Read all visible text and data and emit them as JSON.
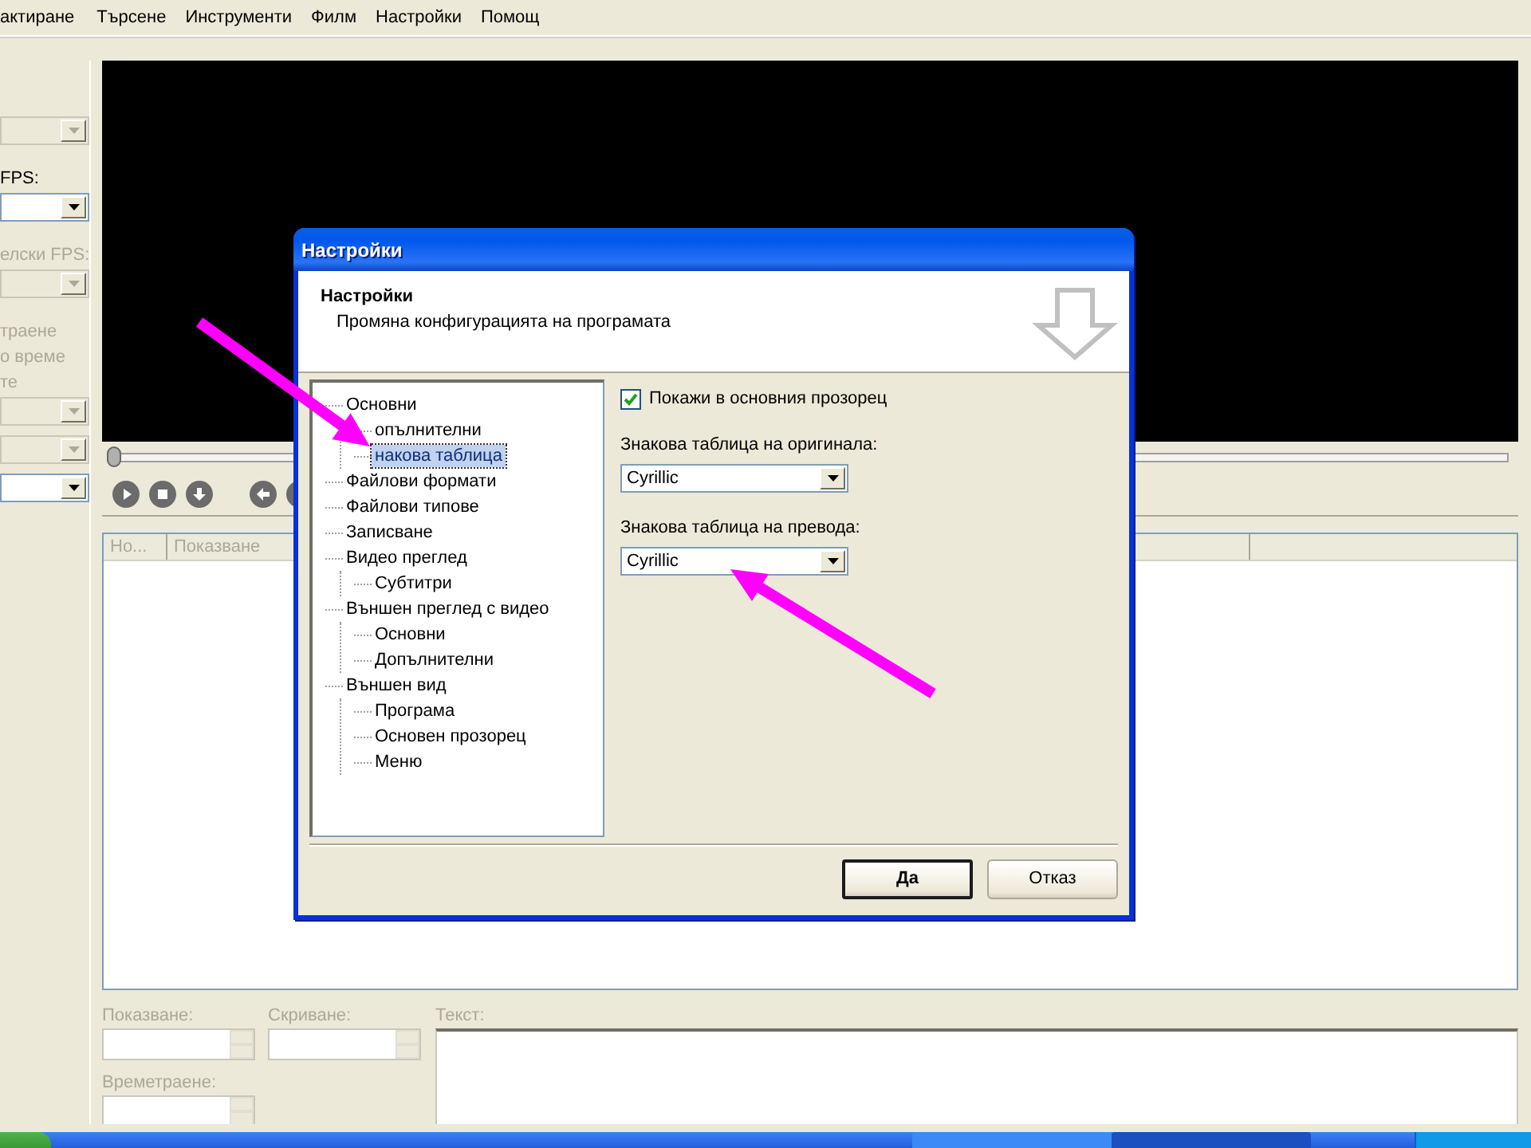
{
  "menu": [
    "актиране",
    "Търсене",
    "Инструменти",
    "Филм",
    "Настройки",
    "Помощ"
  ],
  "left_panel": [
    {
      "kind": "combo",
      "disabled": true
    },
    {
      "kind": "label",
      "text": "FPS:",
      "disabled": false
    },
    {
      "kind": "combo",
      "disabled": false
    },
    {
      "kind": "label",
      "text": "елски FPS:",
      "disabled": true
    },
    {
      "kind": "combo",
      "disabled": true
    },
    {
      "kind": "label",
      "text": "траене",
      "disabled": true
    },
    {
      "kind": "label",
      "text": "о време",
      "disabled": true
    },
    {
      "kind": "label",
      "text": "те",
      "disabled": true
    },
    {
      "kind": "combo",
      "disabled": true
    },
    {
      "kind": "combo",
      "disabled": true
    },
    {
      "kind": "combo",
      "disabled": false
    }
  ],
  "seek_bar": {
    "level": 0
  },
  "subtitle_list": {
    "columns": [
      "Но...",
      "Показване"
    ]
  },
  "edit_panel": {
    "fields": [
      {
        "label": "Показване:",
        "disabled": true
      },
      {
        "label": "Скриване:",
        "disabled": true
      },
      {
        "label": "Времетраене:",
        "disabled": true
      }
    ],
    "text_label": {
      "text": "Текст:",
      "disabled": true
    }
  },
  "dialog": {
    "title": "Настройки",
    "header_title": "Настройки",
    "header_subtitle": "Промяна конфигурацията на програмата",
    "tree": [
      {
        "label": "Основни",
        "selected": false,
        "children": [
          {
            "label": "опълнителни",
            "selected": false
          },
          {
            "label": "накова таблица",
            "selected": true
          }
        ]
      },
      {
        "label": "Файлови формати",
        "selected": false
      },
      {
        "label": "Файлови типове",
        "selected": false
      },
      {
        "label": "Записване",
        "selected": false
      },
      {
        "label": "Видео преглед",
        "selected": false,
        "children": [
          {
            "label": "Субтитри",
            "selected": false
          }
        ]
      },
      {
        "label": "Външен преглед с видео",
        "selected": false,
        "children": [
          {
            "label": "Основни",
            "selected": false
          },
          {
            "label": "Допълнителни",
            "selected": false
          }
        ]
      },
      {
        "label": "Външен вид",
        "selected": false,
        "children": [
          {
            "label": "Програма",
            "selected": false
          },
          {
            "label": "Основен прозорец",
            "selected": false
          },
          {
            "label": "Меню",
            "selected": false
          }
        ]
      }
    ],
    "show_in_main": {
      "label": "Покажи в основния прозорец",
      "checked": true
    },
    "original_charset": {
      "label": "Знакова таблица на оригинала:",
      "value": "Cyrillic"
    },
    "translation_charset": {
      "label": "Знакова таблица на превода:",
      "value": "Cyrillic"
    },
    "buttons": [
      {
        "label": "Да",
        "default": true
      },
      {
        "label": "Отказ",
        "default": false
      }
    ]
  }
}
